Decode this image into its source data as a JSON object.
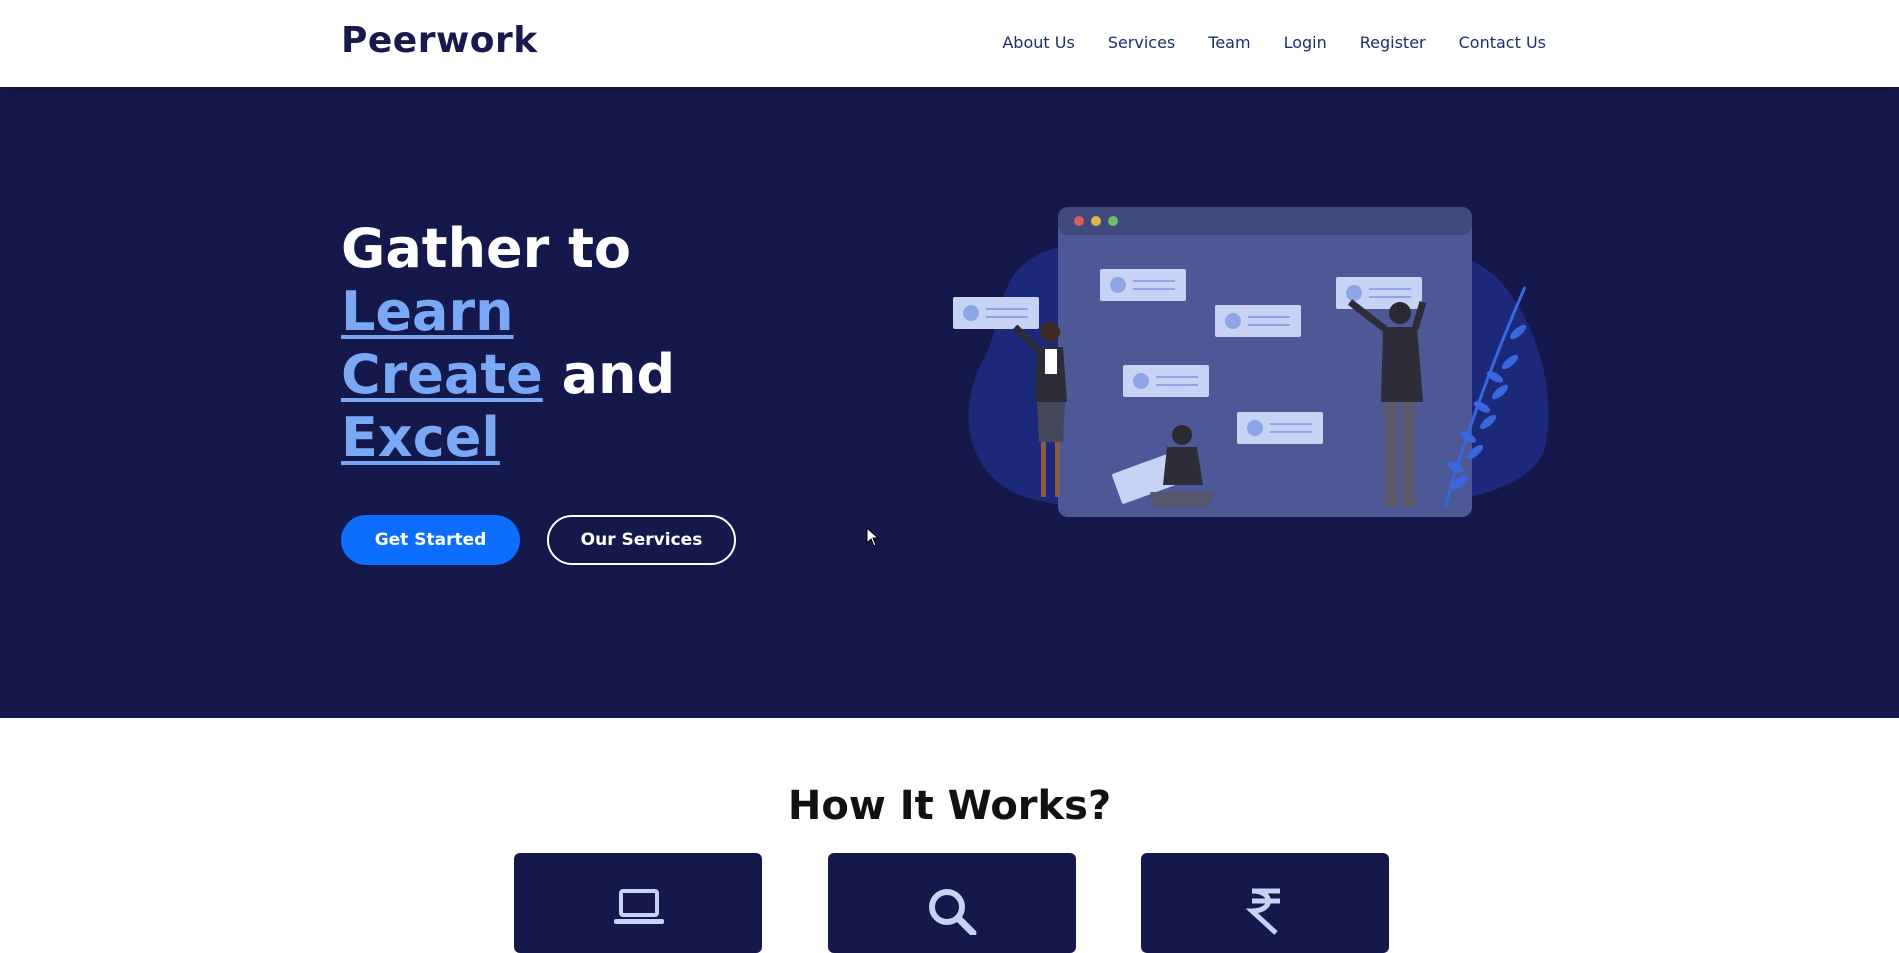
{
  "nav": {
    "logo": "Peerwork",
    "links": [
      "About Us",
      "Services",
      "Team",
      "Login",
      "Register",
      "Contact Us"
    ]
  },
  "hero": {
    "line1": "Gather to",
    "word_learn": "Learn",
    "word_create": "Create",
    "word_and": " and",
    "word_excel": "Excel",
    "btn_primary": "Get Started",
    "btn_secondary": "Our Services"
  },
  "how": {
    "title": "How It Works?",
    "cards": [
      {
        "icon": "laptop-icon"
      },
      {
        "icon": "search-icon"
      },
      {
        "icon": "rupee-icon"
      }
    ]
  },
  "colors": {
    "navy": "#15184a",
    "accent": "#0d6efd",
    "highlight": "#7aa8f5"
  }
}
